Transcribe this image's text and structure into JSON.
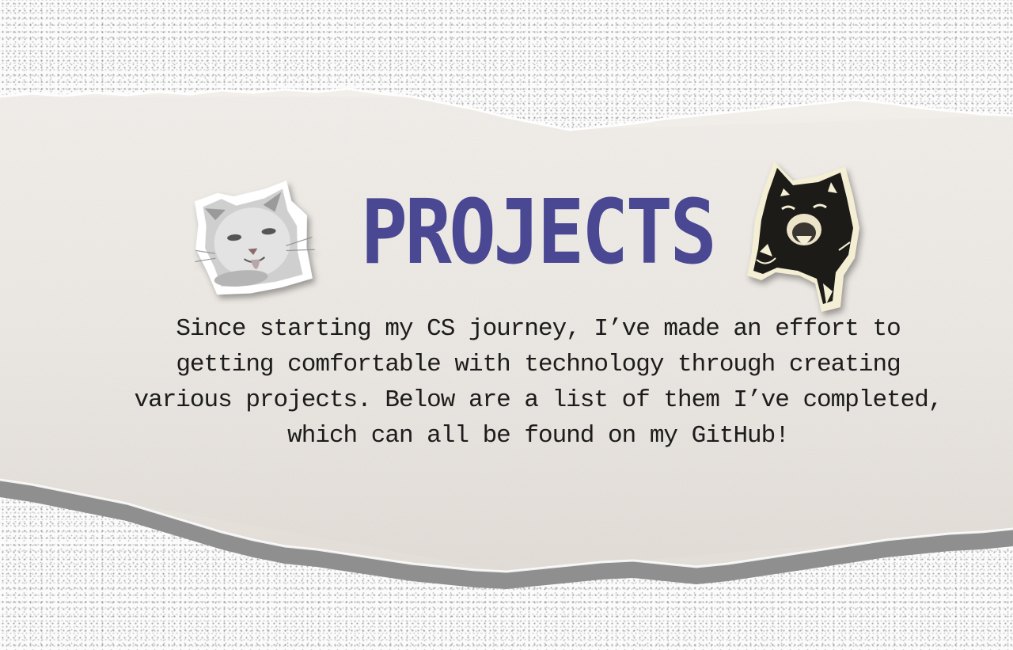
{
  "page": {
    "title": "PROJECTS",
    "intro": "Since starting my CS journey, I’ve made an effort to getting comfortable with technology through creating various projects. Below are a list of them I’ve completed, which can all be found on my GitHub!"
  },
  "colors": {
    "title": "#4a4793",
    "paper": "#ece8e4",
    "paper_shadow": "#8e8e8e",
    "text": "#1c1c1c"
  },
  "icons": {
    "left_sticker": "white-cat-tongue-sticker-icon",
    "right_sticker": "black-cat-yawning-sticker-icon"
  }
}
